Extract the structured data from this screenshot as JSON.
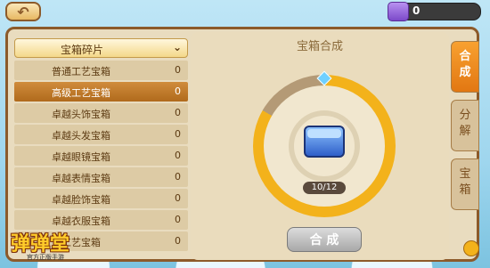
{
  "topbar": {
    "back_icon": "back-arrow-icon",
    "currency": {
      "icon": "purple-gem-icon",
      "value": "0"
    }
  },
  "left_panel": {
    "category": {
      "label": "宝箱碎片",
      "icon": "chevron-down-icon"
    },
    "items": [
      {
        "name": "普通工艺宝箱",
        "count": "0",
        "selected": false
      },
      {
        "name": "高级工艺宝箱",
        "count": "0",
        "selected": true
      },
      {
        "name": "卓越头饰宝箱",
        "count": "0",
        "selected": false
      },
      {
        "name": "卓越头发宝箱",
        "count": "0",
        "selected": false
      },
      {
        "name": "卓越眼镜宝箱",
        "count": "0",
        "selected": false
      },
      {
        "name": "卓越表情宝箱",
        "count": "0",
        "selected": false
      },
      {
        "name": "卓越脸饰宝箱",
        "count": "0",
        "selected": false
      },
      {
        "name": "卓越衣服宝箱",
        "count": "0",
        "selected": false
      },
      {
        "name": "工艺宝箱",
        "count": "0",
        "selected": false
      }
    ]
  },
  "center": {
    "title": "宝箱合成",
    "progress": {
      "text": "10/12",
      "current": 10,
      "total": 12
    },
    "chest_icon": "blue-treasure-chest-icon",
    "combine_label": "合 成"
  },
  "tabs": [
    {
      "label": "合\n成",
      "active": true
    },
    {
      "label": "分\n解",
      "active": false
    },
    {
      "label": "宝\n箱",
      "active": false
    }
  ],
  "logo": {
    "text": "弹弹堂",
    "sub": "官方正版手游"
  },
  "colors": {
    "accent": "#f3b21b",
    "frame": "#8c5a2a",
    "selected_row": "#c07a2a",
    "active_tab": "#f08a1c"
  }
}
